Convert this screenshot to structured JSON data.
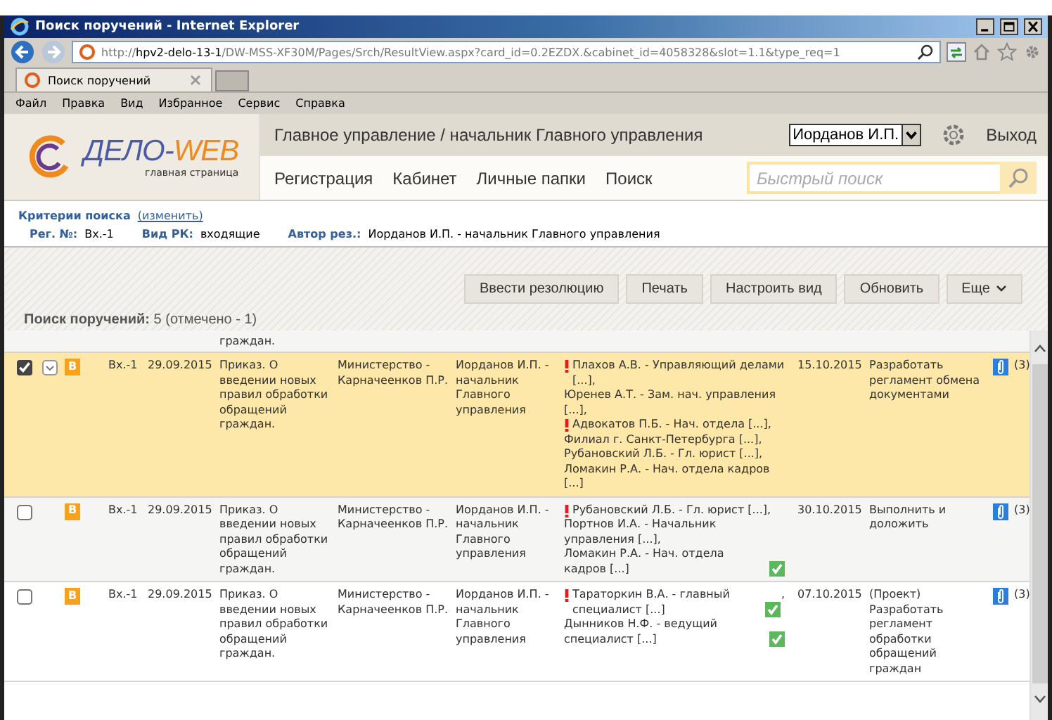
{
  "browser": {
    "title": "Поиск поручений - Internet Explorer",
    "url": "http://**hpv2-delo-13-1**/DW-MSS-XF30M/Pages/Srch/ResultView.aspx?card_id=0.2EZDX.&cabinet_id=4058328&slot=1.1&type_req=1",
    "tab": "Поиск поручений",
    "menu": [
      "Файл",
      "Правка",
      "Вид",
      "Избранное",
      "Сервис",
      "Справка"
    ]
  },
  "app": {
    "logo": {
      "part1": "ДЕЛО-",
      "part2": "WEB",
      "subtitle": "главная страница"
    },
    "heading": "Главное управление / начальник Главного управления",
    "user": "Иорданов И.П.",
    "logout": "Выход",
    "nav": [
      "Регистрация",
      "Кабинет",
      "Личные папки",
      "Поиск"
    ],
    "search_placeholder": "Быстрый поиск"
  },
  "criteria": {
    "title": "Критерии поиска",
    "change_link": "(изменить)",
    "fields": [
      {
        "label": "Рег. №:",
        "value": "Вх.-1"
      },
      {
        "label": "Вид РК:",
        "value": "входящие"
      },
      {
        "label": "Автор рез.:",
        "value": "Иорданов И.П. - начальник Главного управления"
      }
    ]
  },
  "toolbar": {
    "buttons": [
      {
        "label": "Ввести резолюцию",
        "kind": "plain"
      },
      {
        "label": "Печать",
        "kind": "plain"
      },
      {
        "label": "Настроить вид",
        "kind": "plain"
      },
      {
        "label": "Обновить",
        "kind": "plain"
      },
      {
        "label": "Еще",
        "kind": "menu"
      }
    ]
  },
  "summary": "**Поиск поручений:** 5 (отмечено - 1)",
  "partial_row": {
    "content": "граждан."
  },
  "rows": [
    {
      "selected": true,
      "checked": true,
      "badge": "В",
      "reg": "Вх.-1",
      "date": "29.09.2015",
      "content": "Приказ. О введении новых правил обработки обращений граждан.",
      "correspondent": "Министерство - Карначеенков П.Р.",
      "author": "Иорданов И.П. - начальник Главного управления",
      "executors": [
        {
          "text": "Плахов А.В. - Управляющий делами [...],",
          "urgent": true,
          "done": false
        },
        {
          "text": "Юренев А.Т. - Зам. нач. управления [...],",
          "urgent": false,
          "done": false
        },
        {
          "text": "Адвокатов П.Б. - Нач. отдела [...],",
          "urgent": true,
          "done": false
        },
        {
          "text": "Филиал г. Санкт-Петербурга [...],",
          "urgent": false,
          "done": false
        },
        {
          "text": "Рубановский Л.Б. - Гл. юрист [...],",
          "urgent": false,
          "done": false
        },
        {
          "text": "Ломакин Р.А. - Нач. отдела кадров [...]",
          "urgent": false,
          "done": false
        }
      ],
      "due": "15.10.2015",
      "text": "Разработать регламент обмена документами",
      "attachments": "(3)"
    },
    {
      "selected": false,
      "checked": false,
      "badge": "В",
      "reg": "Вх.-1",
      "date": "29.09.2015",
      "content": "Приказ. О введении новых правил обработки обращений граждан.",
      "correspondent": "Министерство - Карначеенков П.Р.",
      "author": "Иорданов И.П. - начальник Главного управления",
      "executors": [
        {
          "text": "Рубановский Л.Б. - Гл. юрист [...],",
          "urgent": true,
          "done": false
        },
        {
          "text": "Портнов И.А. - Начальник управления [...],",
          "urgent": false,
          "done": false
        },
        {
          "text": "Ломакин Р.А. - Нач. отдела кадров [...]",
          "urgent": false,
          "done": true
        }
      ],
      "due": "30.10.2015",
      "text": "Выполнить и доложить",
      "attachments": "(3)"
    },
    {
      "selected": false,
      "checked": false,
      "badge": "В",
      "reg": "Вх.-1",
      "date": "29.09.2015",
      "content": "Приказ. О введении новых правил обработки обращений граждан.",
      "correspondent": "Министерство - Карначеенков П.Р.",
      "author": "Иорданов И.П. - начальник Главного управления",
      "executors": [
        {
          "text": "Тараторкин В.А. - главный специалист [...]",
          "urgent": true,
          "done": true,
          "separator": ","
        },
        {
          "text": "Дынников Н.Ф. - ведущий специалист [...]",
          "urgent": false,
          "done": true
        }
      ],
      "due": "07.10.2015",
      "text": "(Проект) Разработать регламент обработки обращений граждан",
      "attachments": "(3)"
    }
  ]
}
